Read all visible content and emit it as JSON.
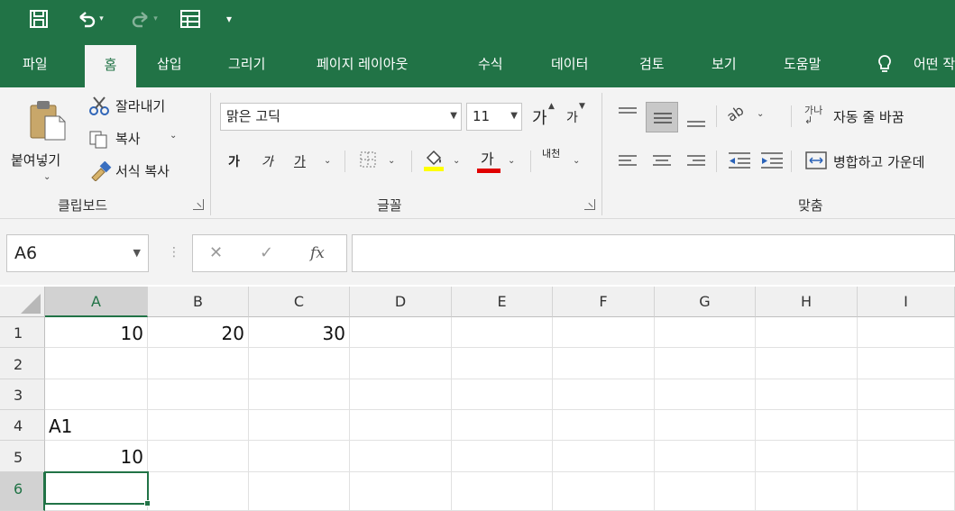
{
  "quick_access": {
    "customize_caret": "▾"
  },
  "tabs": [
    {
      "id": "file",
      "label": "파일"
    },
    {
      "id": "home",
      "label": "홈"
    },
    {
      "id": "insert",
      "label": "삽입"
    },
    {
      "id": "draw",
      "label": "그리기"
    },
    {
      "id": "layout",
      "label": "페이지 레이아웃"
    },
    {
      "id": "formulas",
      "label": "수식"
    },
    {
      "id": "data",
      "label": "데이터"
    },
    {
      "id": "review",
      "label": "검토"
    },
    {
      "id": "view",
      "label": "보기"
    },
    {
      "id": "help",
      "label": "도움말"
    },
    {
      "id": "tellme",
      "label": "어떤 작"
    }
  ],
  "active_tab": "home",
  "clipboard": {
    "paste": "붙여넣기",
    "cut": "잘라내기",
    "copy": "복사",
    "format_painter": "서식 복사",
    "group_label": "클립보드"
  },
  "font": {
    "name": "맑은 고딕",
    "size": "11",
    "increase_size": "가",
    "decrease_size": "가",
    "bold": "가",
    "italic": "가",
    "underline": "가",
    "font_color_glyph": "가",
    "phonetic": "내천",
    "group_label": "글꼴"
  },
  "alignment": {
    "wrap_text": "자동 줄 바꿈",
    "merge_center": "병합하고 가운데",
    "group_label": "맞춤"
  },
  "formula_bar": {
    "name_box": "A6",
    "cancel": "✕",
    "enter": "✓",
    "fx": "fx",
    "content": ""
  },
  "sheet": {
    "columns": [
      "A",
      "B",
      "C",
      "D",
      "E",
      "F",
      "G",
      "H",
      "I"
    ],
    "rows": [
      "1",
      "2",
      "3",
      "4",
      "5",
      "6"
    ],
    "selected_cell": "A6",
    "cells": {
      "A1": "10",
      "B1": "20",
      "C1": "30",
      "A4": "A1",
      "A5": "10"
    }
  },
  "colors": {
    "accent": "#217346",
    "ribbon": "#f3f3f3",
    "fill_highlight": "#ffff00",
    "font_red": "#e00000"
  }
}
